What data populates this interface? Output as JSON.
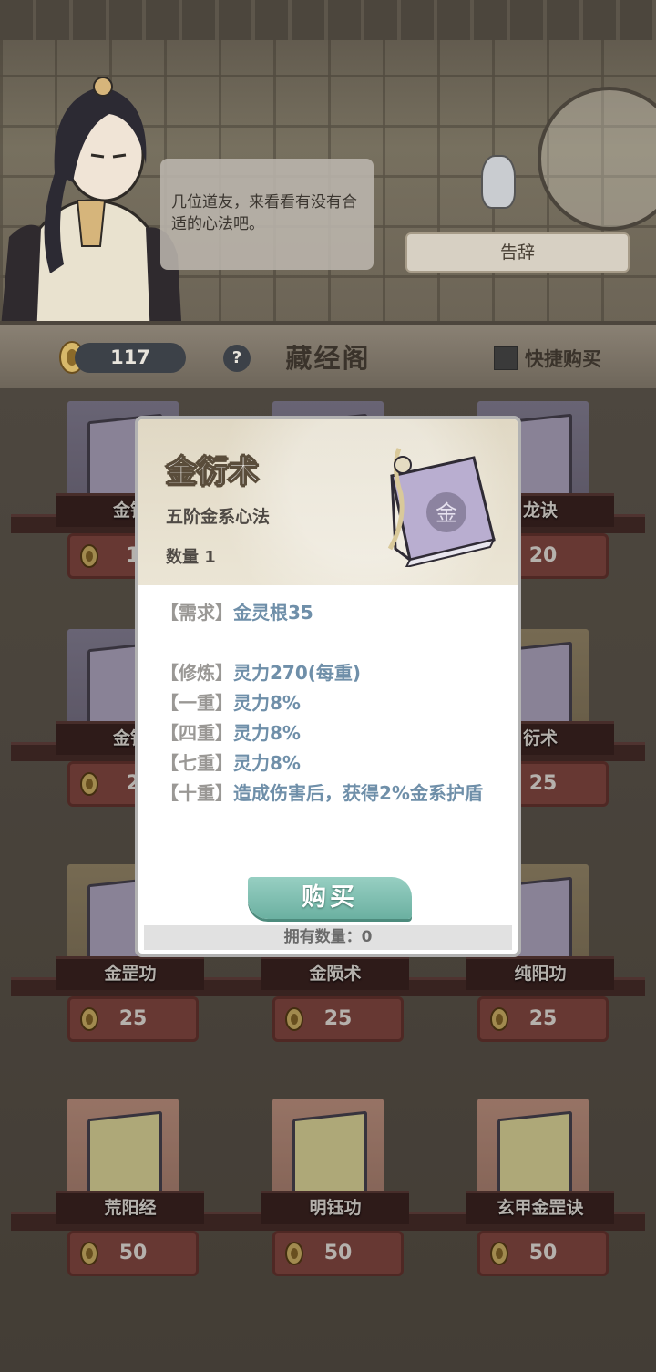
{
  "dialog": {
    "text": "几位道友，来看看有没有合适的心法吧。",
    "farewell_label": "告辞"
  },
  "header": {
    "currency": "117",
    "help_label": "?",
    "title": "藏经阁",
    "quick_buy_label": "快捷购买"
  },
  "shop": {
    "rows": [
      [
        {
          "name": "金钟",
          "price": "1",
          "cover": "purple"
        },
        {
          "name": "",
          "price": "",
          "cover": "purple"
        },
        {
          "name": "龙诀",
          "price": "20",
          "cover": "purple"
        }
      ],
      [
        {
          "name": "金针",
          "price": "2",
          "cover": "purple"
        },
        {
          "name": "",
          "price": "",
          "cover": "tan"
        },
        {
          "name": "衍术",
          "price": "25",
          "cover": "tan"
        }
      ],
      [
        {
          "name": "金罡功",
          "price": "25",
          "cover": "tan"
        },
        {
          "name": "金陨术",
          "price": "25",
          "cover": "tan"
        },
        {
          "name": "纯阳功",
          "price": "25",
          "cover": "tan"
        }
      ],
      [
        {
          "name": "荒阳经",
          "price": "50",
          "cover": "pink"
        },
        {
          "name": "明钰功",
          "price": "50",
          "cover": "pink"
        },
        {
          "name": "玄甲金罡诀",
          "price": "50",
          "cover": "pink"
        }
      ]
    ]
  },
  "modal": {
    "name": "金衍术",
    "subtitle": "五阶金系心法",
    "quantity": "数量 1",
    "book_glyph": "金",
    "requirement": {
      "key": "【需求】",
      "value": "金灵根35"
    },
    "stats": [
      {
        "key": "【修炼】",
        "value": "灵力270(每重)"
      },
      {
        "key": "【一重】",
        "value": "灵力8%"
      },
      {
        "key": "【四重】",
        "value": "灵力8%"
      },
      {
        "key": "【七重】",
        "value": "灵力8%"
      },
      {
        "key": "【十重】",
        "value": "造成伤害后，获得2%金系护盾"
      }
    ],
    "buy_label": "购买",
    "owned": "拥有数量：0"
  },
  "colors": {
    "stat_value": "#6f8fa9",
    "stat_key": "#9a9895",
    "buy_button": "#7fbfb0",
    "price_tag": "#8a4b45"
  }
}
